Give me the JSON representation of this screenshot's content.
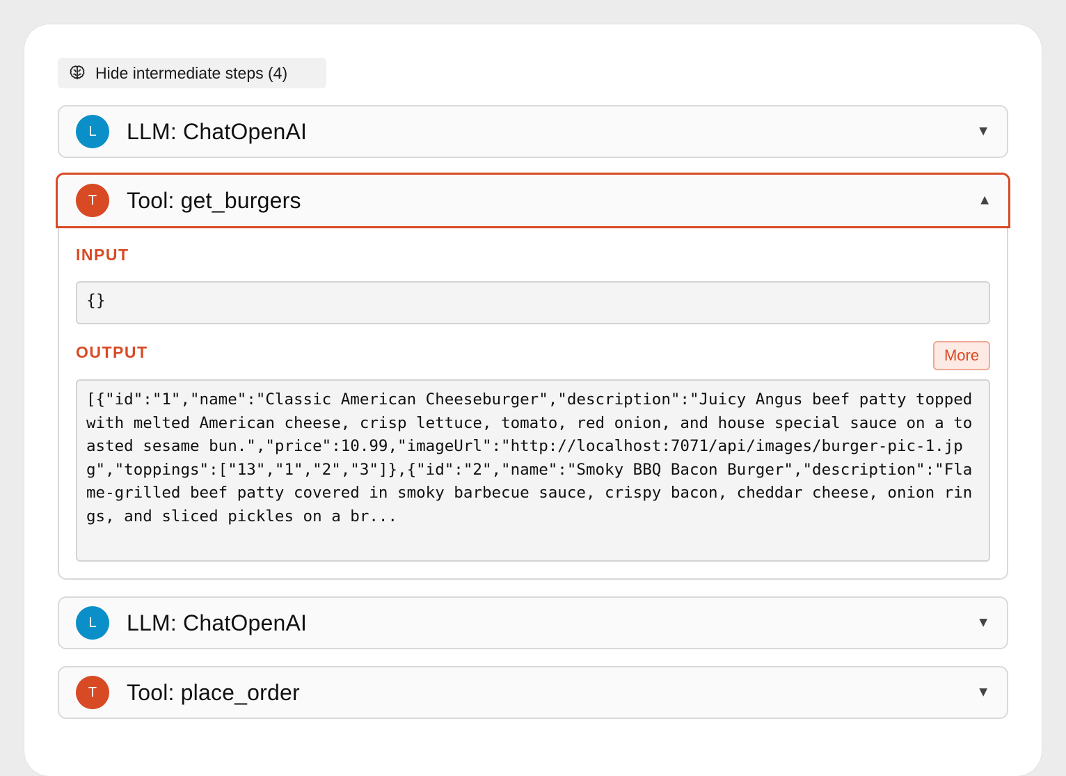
{
  "toggle": {
    "label": "Hide intermediate steps (4)",
    "icon": "brain-icon"
  },
  "steps": [
    {
      "badge": "L",
      "title": "LLM: ChatOpenAI",
      "caret": "▼",
      "expanded": false
    },
    {
      "badge": "T",
      "title": "Tool: get_burgers",
      "caret": "▲",
      "expanded": true,
      "input_label": "INPUT",
      "input_value": "{}",
      "output_label": "OUTPUT",
      "more_label": "More",
      "output_value": "[{\"id\":\"1\",\"name\":\"Classic American Cheeseburger\",\"description\":\"Juicy Angus beef patty topped with melted American cheese, crisp lettuce, tomato, red onion, and house special sauce on a toasted sesame bun.\",\"price\":10.99,\"imageUrl\":\"http://localhost:7071/api/images/burger-pic-1.jpg\",\"toppings\":[\"13\",\"1\",\"2\",\"3\"]},{\"id\":\"2\",\"name\":\"Smoky BBQ Bacon Burger\",\"description\":\"Flame-grilled beef patty covered in smoky barbecue sauce, crispy bacon, cheddar cheese, onion rings, and sliced pickles on a br..."
    },
    {
      "badge": "L",
      "title": "LLM: ChatOpenAI",
      "caret": "▼",
      "expanded": false
    },
    {
      "badge": "T",
      "title": "Tool: place_order",
      "caret": "▼",
      "expanded": false
    }
  ],
  "colors": {
    "llm_badge": "#0a8fc9",
    "tool_badge": "#d84a24",
    "accent": "#d84a24"
  }
}
